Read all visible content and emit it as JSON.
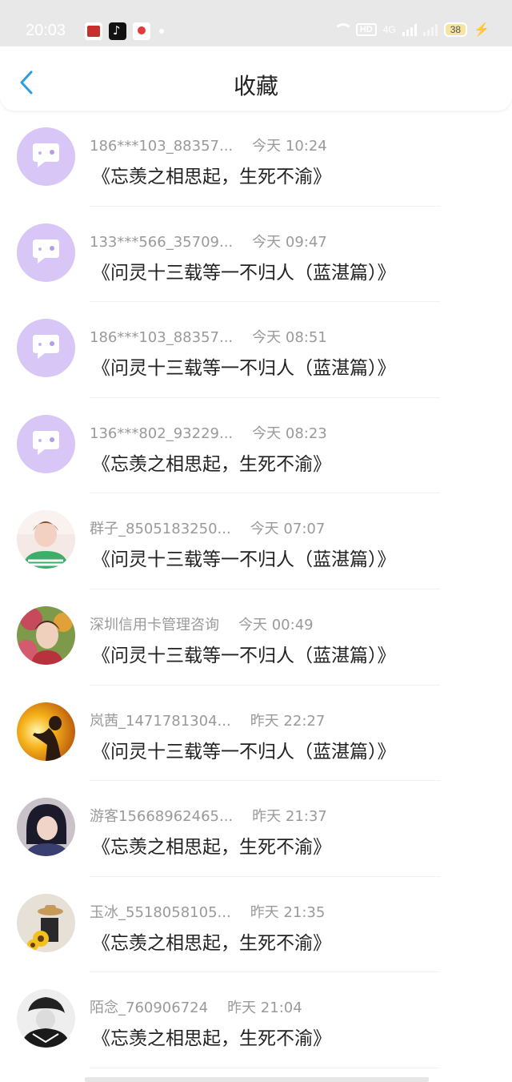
{
  "status": {
    "time": "20:03",
    "battery": "38",
    "network": "4G",
    "hd": "HD"
  },
  "header": {
    "title": "收藏"
  },
  "items": [
    {
      "name": "186***103_88357...",
      "time": "今天 10:24",
      "title": "《忘羡之相思起，生死不渝》",
      "avatar": "default-chat"
    },
    {
      "name": "133***566_35709...",
      "time": "今天 09:47",
      "title": "《问灵十三载等一不归人（蓝湛篇）》",
      "avatar": "default-chat"
    },
    {
      "name": "186***103_88357...",
      "time": "今天 08:51",
      "title": "《问灵十三载等一不归人（蓝湛篇）》",
      "avatar": "default-chat"
    },
    {
      "name": "136***802_93229...",
      "time": "今天 08:23",
      "title": "《忘羡之相思起，生死不渝》",
      "avatar": "default-chat"
    },
    {
      "name": "群子_8505183250...",
      "time": "今天 07:07",
      "title": "《问灵十三载等一不归人（蓝湛篇）》",
      "avatar": "photo-woman-green"
    },
    {
      "name": "深圳信用卡管理咨询",
      "time": "今天 00:49",
      "title": "《问灵十三载等一不归人（蓝湛篇）》",
      "avatar": "photo-flowers"
    },
    {
      "name": "岚茜_1471781304...",
      "time": "昨天 22:27",
      "title": "《问灵十三载等一不归人（蓝湛篇）》",
      "avatar": "photo-sunset"
    },
    {
      "name": "游客15668962465...",
      "time": "昨天 21:37",
      "title": "《忘羡之相思起，生死不渝》",
      "avatar": "photo-woman-dark"
    },
    {
      "name": "玉冰_5518058105...",
      "time": "昨天 21:35",
      "title": "《忘羡之相思起，生死不渝》",
      "avatar": "photo-sunflower"
    },
    {
      "name": "陌念_760906724",
      "time": "昨天 21:04",
      "title": "《忘羡之相思起，生死不渝》",
      "avatar": "photo-bw"
    }
  ],
  "colors": {
    "accent": "#2a9ee0",
    "avatar_default_bg": "#d8c6f6",
    "meta_text": "#9a9a9a"
  }
}
